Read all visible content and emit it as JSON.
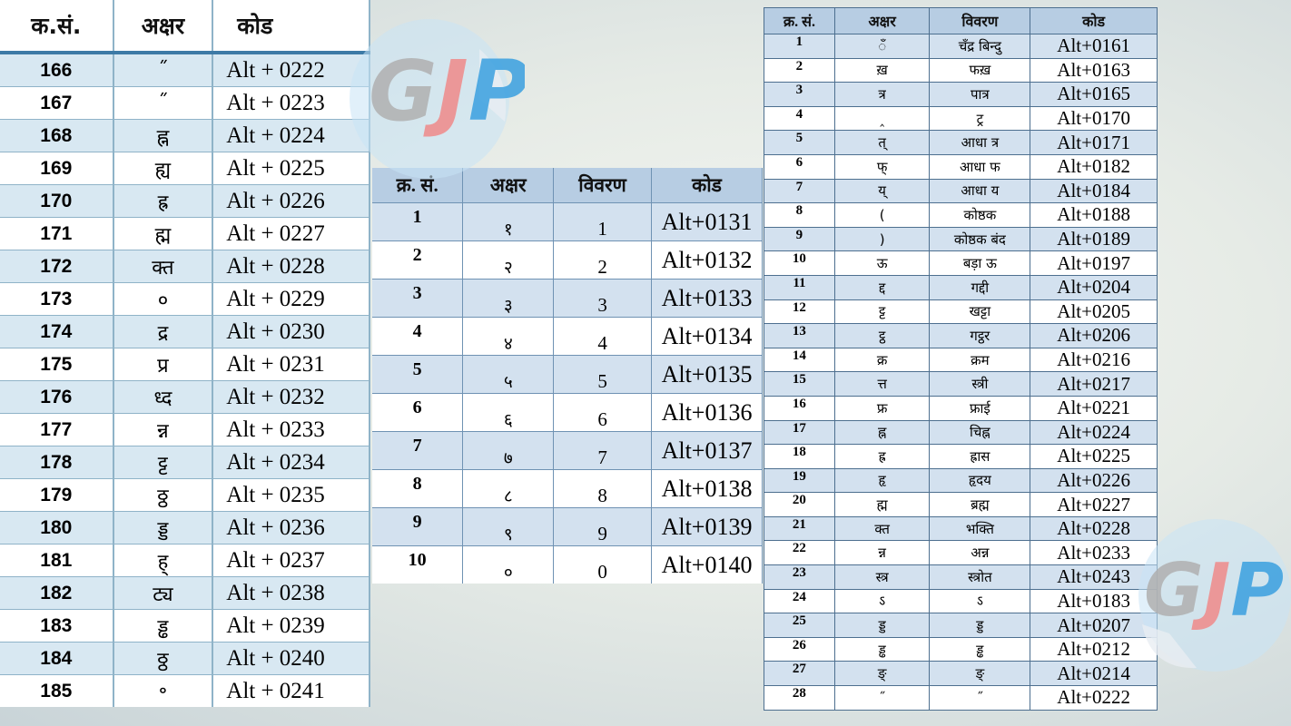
{
  "watermark": {
    "text": "GJP",
    "colors": {
      "g": "#b0b0b0",
      "j": "#f08a8a",
      "p": "#3aa0e0",
      "circle": "#c9e4f5"
    }
  },
  "left_table": {
    "headers": [
      "क.सं.",
      "अक्षर",
      "कोड"
    ],
    "rows": [
      [
        "166",
        "˝",
        "Alt + 0222"
      ],
      [
        "167",
        "˝",
        "Alt + 0223"
      ],
      [
        "168",
        "ह्न",
        "Alt + 0224"
      ],
      [
        "169",
        "ह्य",
        "Alt + 0225"
      ],
      [
        "170",
        "ह्र",
        "Alt + 0226"
      ],
      [
        "171",
        "ह्म",
        "Alt + 0227"
      ],
      [
        "172",
        "क्त",
        "Alt + 0228"
      ],
      [
        "173",
        "०",
        "Alt + 0229"
      ],
      [
        "174",
        "द्र",
        "Alt + 0230"
      ],
      [
        "175",
        "प्र",
        "Alt + 0231"
      ],
      [
        "176",
        "ध्द",
        "Alt + 0232"
      ],
      [
        "177",
        "न्न",
        "Alt + 0233"
      ],
      [
        "178",
        "ट्ट",
        "Alt + 0234"
      ],
      [
        "179",
        "ठ्ठ",
        "Alt + 0235"
      ],
      [
        "180",
        "ड्ड",
        "Alt + 0236"
      ],
      [
        "181",
        "ह्",
        "Alt + 0237"
      ],
      [
        "182",
        "ट्य",
        "Alt + 0238"
      ],
      [
        "183",
        "ड्ढ",
        "Alt + 0239"
      ],
      [
        "184",
        "ठ्ठ",
        "Alt + 0240"
      ],
      [
        "185",
        "॰",
        "Alt + 0241"
      ]
    ]
  },
  "middle_table": {
    "headers": [
      "क्र. सं.",
      "अक्षर",
      "विवरण",
      "कोड"
    ],
    "rows": [
      [
        "1",
        "१",
        "1",
        "Alt+0131"
      ],
      [
        "2",
        "२",
        "2",
        "Alt+0132"
      ],
      [
        "3",
        "३",
        "3",
        "Alt+0133"
      ],
      [
        "4",
        "४",
        "4",
        "Alt+0134"
      ],
      [
        "5",
        "५",
        "5",
        "Alt+0135"
      ],
      [
        "6",
        "६",
        "6",
        "Alt+0136"
      ],
      [
        "7",
        "७",
        "7",
        "Alt+0137"
      ],
      [
        "8",
        "८",
        "8",
        "Alt+0138"
      ],
      [
        "9",
        "९",
        "9",
        "Alt+0139"
      ],
      [
        "10",
        "०",
        "0",
        "Alt+0140"
      ]
    ]
  },
  "right_table": {
    "headers": [
      "क्र. सं.",
      "अक्षर",
      "विवरण",
      "कोड"
    ],
    "rows": [
      [
        "1",
        "ँ",
        "चँद्र बिन्दु",
        "Alt+0161"
      ],
      [
        "2",
        "ख़",
        "फख़",
        "Alt+0163"
      ],
      [
        "3",
        "त्र",
        "पात्र",
        "Alt+0165"
      ],
      [
        "4",
        "‸",
        "ट्र",
        "Alt+0170"
      ],
      [
        "5",
        "त्",
        "आधा त्र",
        "Alt+0171"
      ],
      [
        "6",
        "फ्",
        "आधा फ",
        "Alt+0182"
      ],
      [
        "7",
        "य्",
        "आधा य",
        "Alt+0184"
      ],
      [
        "8",
        "(",
        "कोष्ठक",
        "Alt+0188"
      ],
      [
        "9",
        ")",
        "कोष्ठक बंद",
        "Alt+0189"
      ],
      [
        "10",
        "ऊ",
        "बड़ा ऊ",
        "Alt+0197"
      ],
      [
        "11",
        "द्द",
        "गद्दी",
        "Alt+0204"
      ],
      [
        "12",
        "ट्ट",
        "खट्टा",
        "Alt+0205"
      ],
      [
        "13",
        "ट्ठ",
        "गट्ठर",
        "Alt+0206"
      ],
      [
        "14",
        "क्र",
        "क्रम",
        "Alt+0216"
      ],
      [
        "15",
        "त्त",
        "स्त्री",
        "Alt+0217"
      ],
      [
        "16",
        "फ्र",
        "फ्राई",
        "Alt+0221"
      ],
      [
        "17",
        "ह्न",
        "चिह्न",
        "Alt+0224"
      ],
      [
        "18",
        "ह्र",
        "ह्रास",
        "Alt+0225"
      ],
      [
        "19",
        "हृ",
        "हृदय",
        "Alt+0226"
      ],
      [
        "20",
        "ह्म",
        "ब्रह्म",
        "Alt+0227"
      ],
      [
        "21",
        "क्त",
        "भक्ति",
        "Alt+0228"
      ],
      [
        "22",
        "न्न",
        "अन्न",
        "Alt+0233"
      ],
      [
        "23",
        "स्त्र",
        "स्त्रोत",
        "Alt+0243"
      ],
      [
        "24",
        "ऽ",
        "ऽ",
        "Alt+0183"
      ],
      [
        "25",
        "ड्ड",
        "ड्ड",
        "Alt+0207"
      ],
      [
        "26",
        "ड्ढ",
        "ड्ढ",
        "Alt+0212"
      ],
      [
        "27",
        "ङ्",
        "ङ्",
        "Alt+0214"
      ],
      [
        "28",
        "˝",
        "˝",
        "Alt+0222"
      ]
    ]
  }
}
